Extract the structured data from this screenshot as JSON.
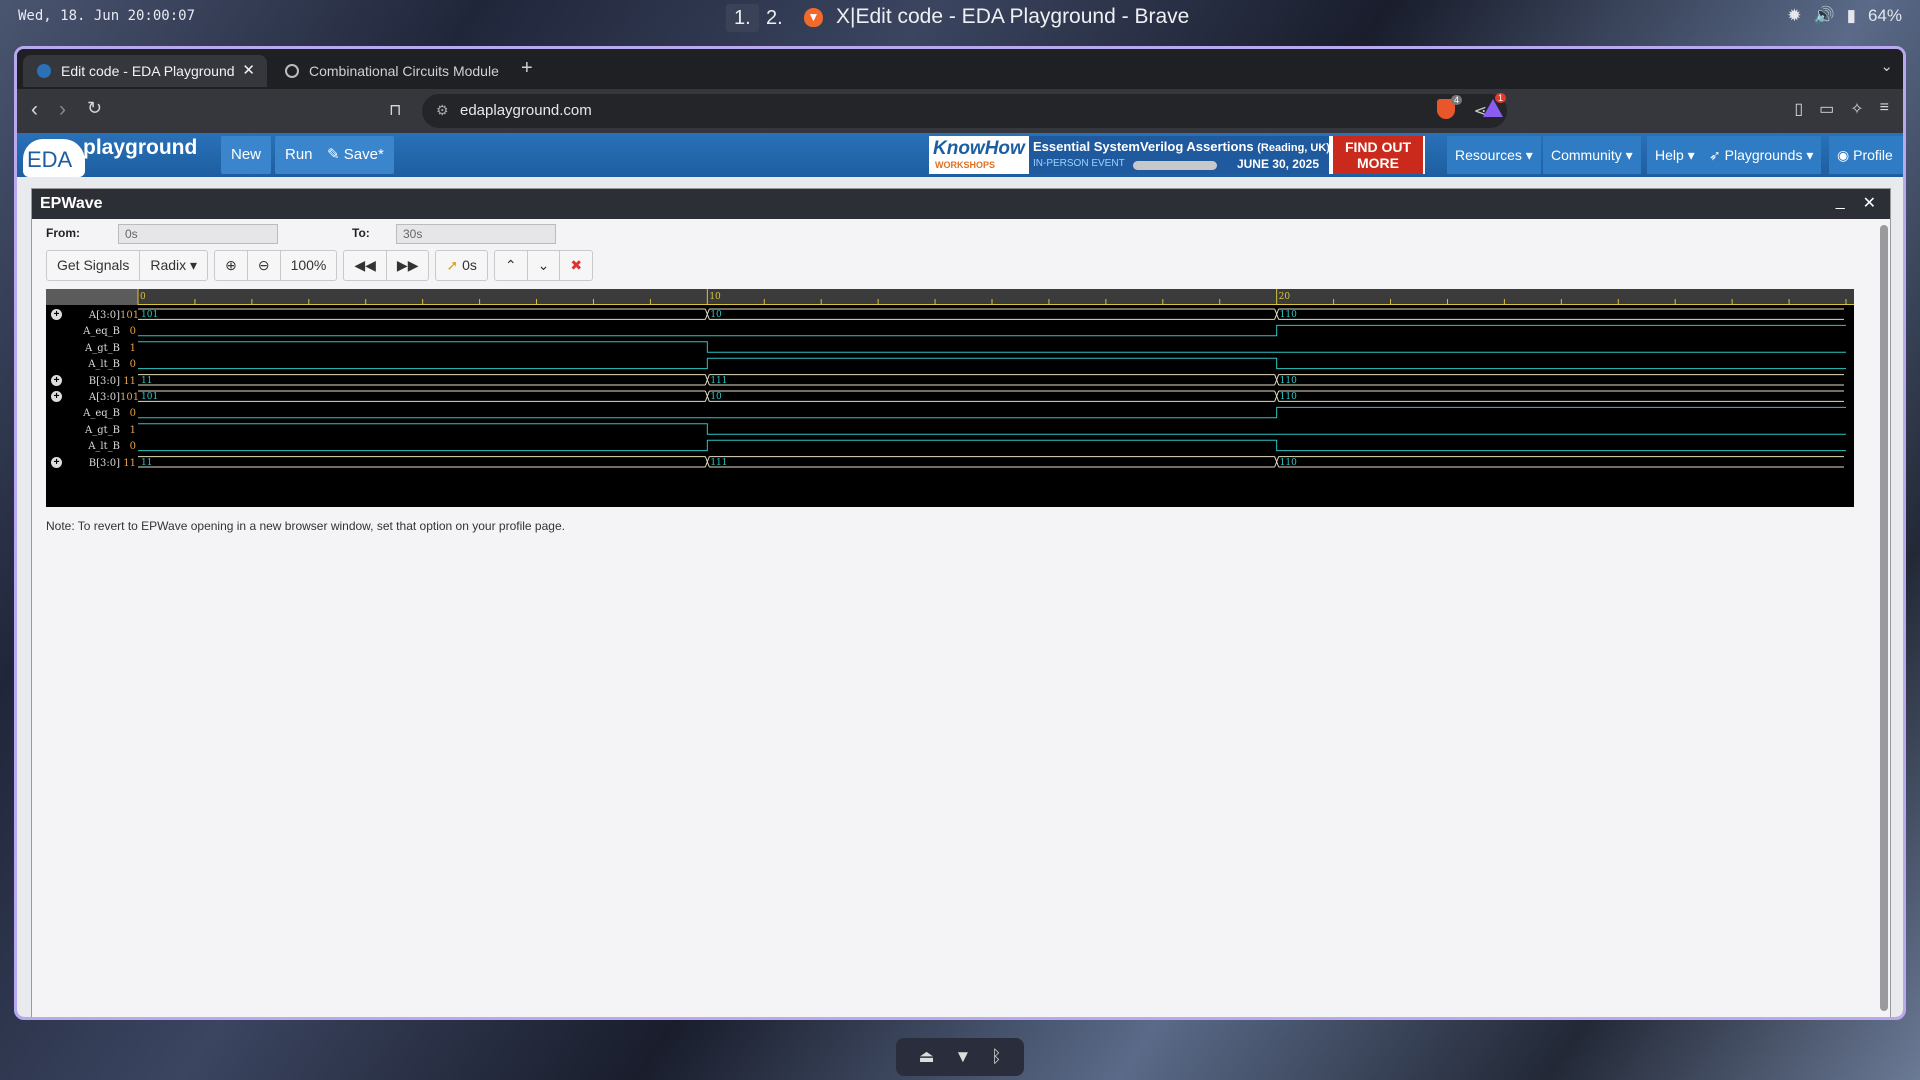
{
  "system_bar": {
    "clock": "Wed, 18. Jun  20:00:07",
    "workspaces": [
      "1.",
      "2."
    ],
    "active_workspace": "1.",
    "window_title": "X|Edit code - EDA Playground - Brave",
    "battery": "64%",
    "tray_icons": [
      "settings-icon",
      "volume-icon",
      "battery-icon"
    ]
  },
  "browser": {
    "tabs": [
      {
        "label": "Edit code - EDA Playground",
        "active": true
      },
      {
        "label": "Combinational Circuits Module",
        "active": false
      }
    ],
    "url": "edaplayground.com",
    "shields_badge": "4",
    "rewards_badge": "1"
  },
  "eda_nav": {
    "logo_text": "EDA",
    "logo_brand": "playground",
    "buttons": [
      "New",
      "Run",
      "Save*"
    ],
    "banner": {
      "brand_main": "KnowHow",
      "brand_sub": "WORKSHOPS",
      "title": "Essential SystemVerilog Assertions",
      "title_suffix": "(Reading, UK)",
      "event_type": "IN-PERSON EVENT",
      "date": "JUNE 30, 2025",
      "cta": "FIND OUT MORE"
    },
    "menus": [
      "Resources",
      "Community",
      "Help",
      "Playgrounds",
      "Profile"
    ]
  },
  "epwave": {
    "title": "EPWave",
    "from_label": "From:",
    "from_value": "0s",
    "to_label": "To:",
    "to_value": "30s",
    "toolbar": {
      "get_signals": "Get Signals",
      "radix": "Radix",
      "zoom_level": "100%",
      "cursor_time": "0s"
    },
    "note": "Note: To revert to EPWave opening in a new browser window, set that option on your profile page."
  },
  "wave_data": {
    "time_range": [
      0,
      30
    ],
    "ruler_labels": [
      0,
      10,
      20
    ],
    "signals": [
      {
        "name": "A[3:0]",
        "value": "101",
        "bus": true,
        "segments": [
          {
            "t0": 0,
            "t1": 10,
            "label": "101"
          },
          {
            "t0": 10,
            "t1": 20,
            "label": "10"
          },
          {
            "t0": 20,
            "t1": 30,
            "label": "110"
          }
        ]
      },
      {
        "name": "A_eq_B",
        "value": "0",
        "bus": false,
        "levels": [
          {
            "t": 0,
            "v": 0
          },
          {
            "t": 20,
            "v": 1
          }
        ]
      },
      {
        "name": "A_gt_B",
        "value": "1",
        "bus": false,
        "levels": [
          {
            "t": 0,
            "v": 1
          },
          {
            "t": 10,
            "v": 0
          }
        ]
      },
      {
        "name": "A_lt_B",
        "value": "0",
        "bus": false,
        "levels": [
          {
            "t": 0,
            "v": 0
          },
          {
            "t": 10,
            "v": 1
          },
          {
            "t": 20,
            "v": 0
          }
        ]
      },
      {
        "name": "B[3:0]",
        "value": "11",
        "bus": true,
        "segments": [
          {
            "t0": 0,
            "t1": 10,
            "label": "11"
          },
          {
            "t0": 10,
            "t1": 20,
            "label": "111"
          },
          {
            "t0": 20,
            "t1": 30,
            "label": "110"
          }
        ]
      },
      {
        "name": "A[3:0]",
        "value": "101",
        "bus": true,
        "segments": [
          {
            "t0": 0,
            "t1": 10,
            "label": "101"
          },
          {
            "t0": 10,
            "t1": 20,
            "label": "10"
          },
          {
            "t0": 20,
            "t1": 30,
            "label": "110"
          }
        ]
      },
      {
        "name": "A_eq_B",
        "value": "0",
        "bus": false,
        "levels": [
          {
            "t": 0,
            "v": 0
          },
          {
            "t": 20,
            "v": 1
          }
        ]
      },
      {
        "name": "A_gt_B",
        "value": "1",
        "bus": false,
        "levels": [
          {
            "t": 0,
            "v": 1
          },
          {
            "t": 10,
            "v": 0
          }
        ]
      },
      {
        "name": "A_lt_B",
        "value": "0",
        "bus": false,
        "levels": [
          {
            "t": 0,
            "v": 0
          },
          {
            "t": 10,
            "v": 1
          },
          {
            "t": 20,
            "v": 0
          }
        ]
      },
      {
        "name": "B[3:0]",
        "value": "11",
        "bus": true,
        "segments": [
          {
            "t0": 0,
            "t1": 10,
            "label": "11"
          },
          {
            "t0": 10,
            "t1": 20,
            "label": "111"
          },
          {
            "t0": 20,
            "t1": 30,
            "label": "110"
          }
        ]
      }
    ],
    "colors": {
      "wire": "#2ec4c4",
      "bus_line": "#e6dcc0",
      "ruler": "#d8c23a",
      "value": "#e7a14a"
    }
  },
  "dock": {
    "icons": [
      "eject-icon",
      "wifi-icon",
      "bluetooth-icon"
    ]
  }
}
